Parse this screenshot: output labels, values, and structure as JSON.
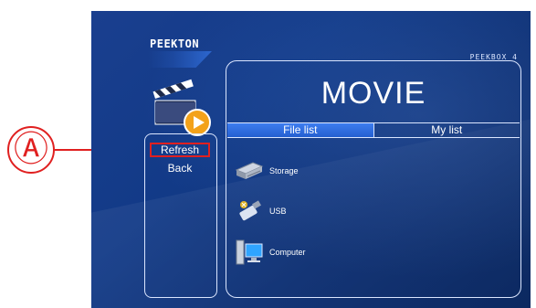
{
  "annotation": {
    "marker": "Ⓐ"
  },
  "header": {
    "brand": "PEEKTON",
    "model": "PEEKBOX 4"
  },
  "main": {
    "title": "MOVIE",
    "tabs": [
      {
        "label": "File list",
        "active": true
      },
      {
        "label": "My list",
        "active": false
      }
    ],
    "items": [
      {
        "label": "Storage",
        "icon": "hard-drive-icon"
      },
      {
        "label": "USB",
        "icon": "usb-icon"
      },
      {
        "label": "Computer",
        "icon": "computer-icon"
      }
    ]
  },
  "side_menu": {
    "items": [
      {
        "label": "Refresh",
        "highlighted": true
      },
      {
        "label": "Back",
        "highlighted": false
      }
    ]
  },
  "colors": {
    "background": "#123a87",
    "tab_active": "#3d7df0",
    "highlight": "#e02020",
    "border": "#dbe6ff"
  }
}
